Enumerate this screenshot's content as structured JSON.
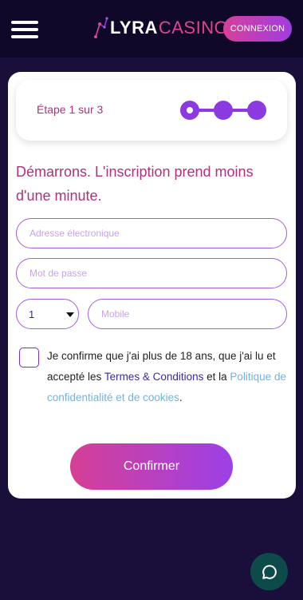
{
  "header": {
    "logo_lyra": "LYRA",
    "logo_casino": "CASINO",
    "login_label": "CONNEXION",
    "menu_icon": "hamburger-menu-icon",
    "logo_icon": "constellation-logo-icon"
  },
  "form": {
    "step_text": "Étape 1 sur 3",
    "current_step": 1,
    "total_steps": 3,
    "headline": "Démarrons. L'inscription prend moins d'une minute.",
    "email_placeholder": "Adresse électronique",
    "password_placeholder": "Mot de passe",
    "country_code": "1",
    "mobile_placeholder": "Mobile",
    "consent_part1": "Je confirme que j'ai plus de 18 ans, que j'ai lu et accepté les ",
    "terms_link": "Termes & Conditions",
    "consent_part2": " et la ",
    "policy_link": "Politique de confidentialité et de cookies",
    "consent_end": ".",
    "checkbox_checked": false,
    "confirm_label": "Confirmer"
  },
  "chat": {
    "icon": "chat-bubble-icon"
  },
  "colors": {
    "background": "#1a0f3a",
    "accent_pink": "#d6409a",
    "accent_purple": "#8b3ae0",
    "heading_text": "#b0307e",
    "chat_button": "#0d4a4a"
  }
}
